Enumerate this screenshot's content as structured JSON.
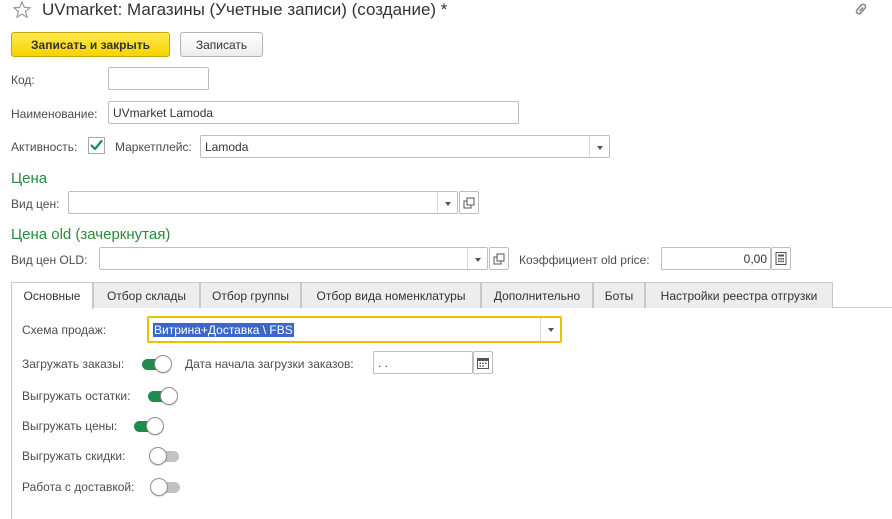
{
  "window": {
    "title": "UVmarket: Магазины (Учетные записи) (создание) *"
  },
  "toolbar": {
    "save_close_label": "Записать и закрыть",
    "save_label": "Записать"
  },
  "form": {
    "code_label": "Код:",
    "code_value": "",
    "name_label": "Наименование:",
    "name_value": "UVmarket Lamoda",
    "active_label": "Активность:",
    "active_checked": true,
    "marketplace_label": "Маркетплейс:",
    "marketplace_value": "Lamoda"
  },
  "price": {
    "heading": "Цена",
    "price_type_label": "Вид цен:",
    "price_type_value": ""
  },
  "old_price": {
    "heading": "Цена old (зачеркнутая)",
    "price_type_label": "Вид цен OLD:",
    "price_type_value": "",
    "coef_label": "Коэффициент old price:",
    "coef_value": "0,00"
  },
  "tabs": [
    {
      "label": "Основные",
      "active": true
    },
    {
      "label": "Отбор склады",
      "active": false
    },
    {
      "label": "Отбор группы",
      "active": false
    },
    {
      "label": "Отбор вида номенклатуры",
      "active": false
    },
    {
      "label": "Дополнительно",
      "active": false
    },
    {
      "label": "Боты",
      "active": false
    },
    {
      "label": "Настройки реестра отгрузки",
      "active": false
    }
  ],
  "main": {
    "sales_scheme_label": "Схема продаж:",
    "sales_scheme_value": "Витрина+Доставка \\ FBS",
    "load_orders_label": "Загружать заказы:",
    "load_orders_on": true,
    "orders_start_date_label": "Дата начала загрузки заказов:",
    "orders_start_date_value": " .  .",
    "upload_stock_label": "Выгружать остатки:",
    "upload_stock_on": true,
    "upload_prices_label": "Выгружать цены:",
    "upload_prices_on": true,
    "upload_discounts_label": "Выгружать скидки:",
    "upload_discounts_on": false,
    "delivery_label": "Работа с доставкой:",
    "delivery_on": false
  },
  "colors": {
    "accent_green": "#2a8a3c",
    "primary_yellow": "#f5d400",
    "toggle_on": "#1f8b4c",
    "focus_border": "#f0c000"
  }
}
